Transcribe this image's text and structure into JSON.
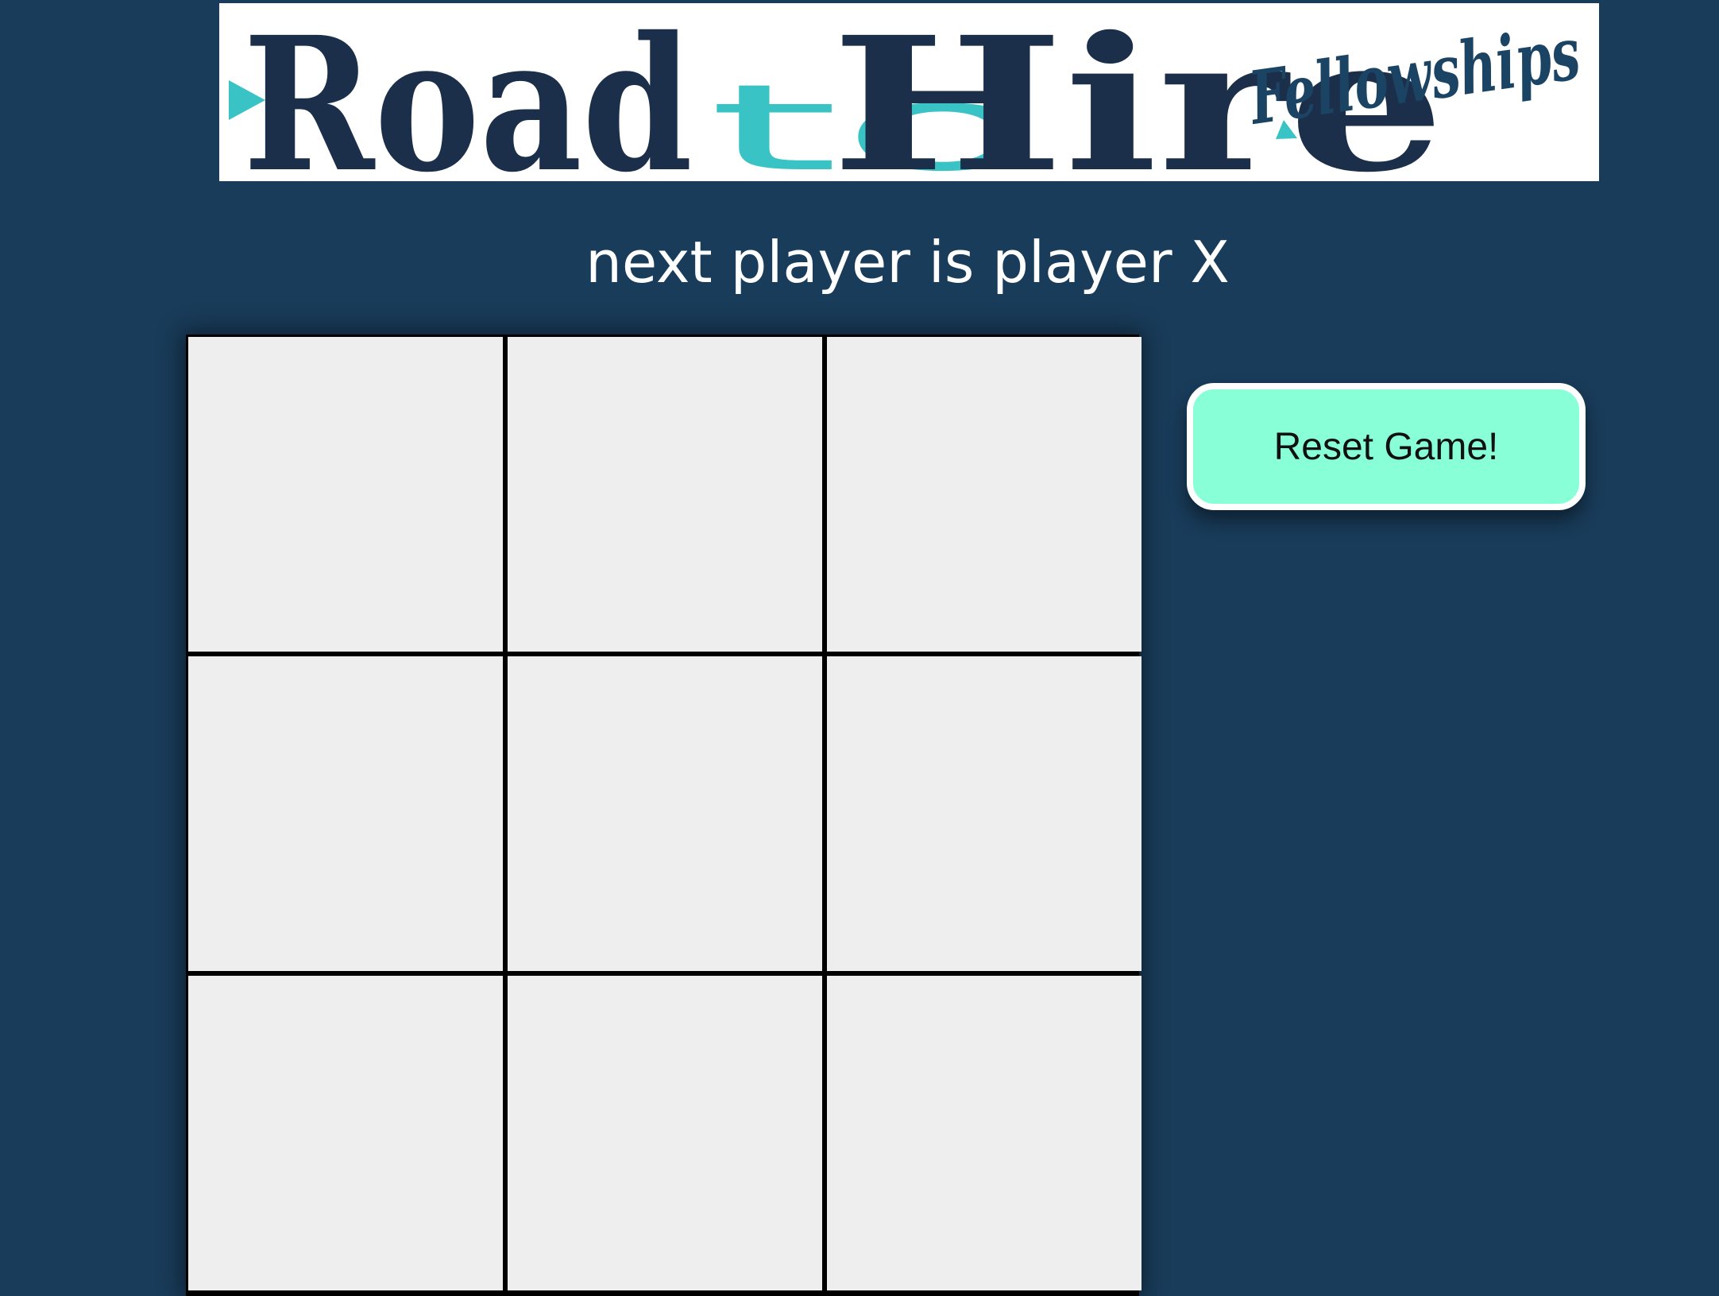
{
  "logo": {
    "word_road": "Road",
    "word_to": "to",
    "word_hire": "Hire",
    "word_fellowships": "Fellowships"
  },
  "status": {
    "text": "next player is player X"
  },
  "board": {
    "cells": [
      "",
      "",
      "",
      "",
      "",
      "",
      "",
      "",
      ""
    ]
  },
  "controls": {
    "reset_label": "Reset Game!"
  },
  "colors": {
    "page_background": "#193c5a",
    "logo_navy": "#1b2f4a",
    "logo_teal": "#39c3c5",
    "cell_background": "#eeeeee",
    "button_background": "#88ffd7"
  }
}
